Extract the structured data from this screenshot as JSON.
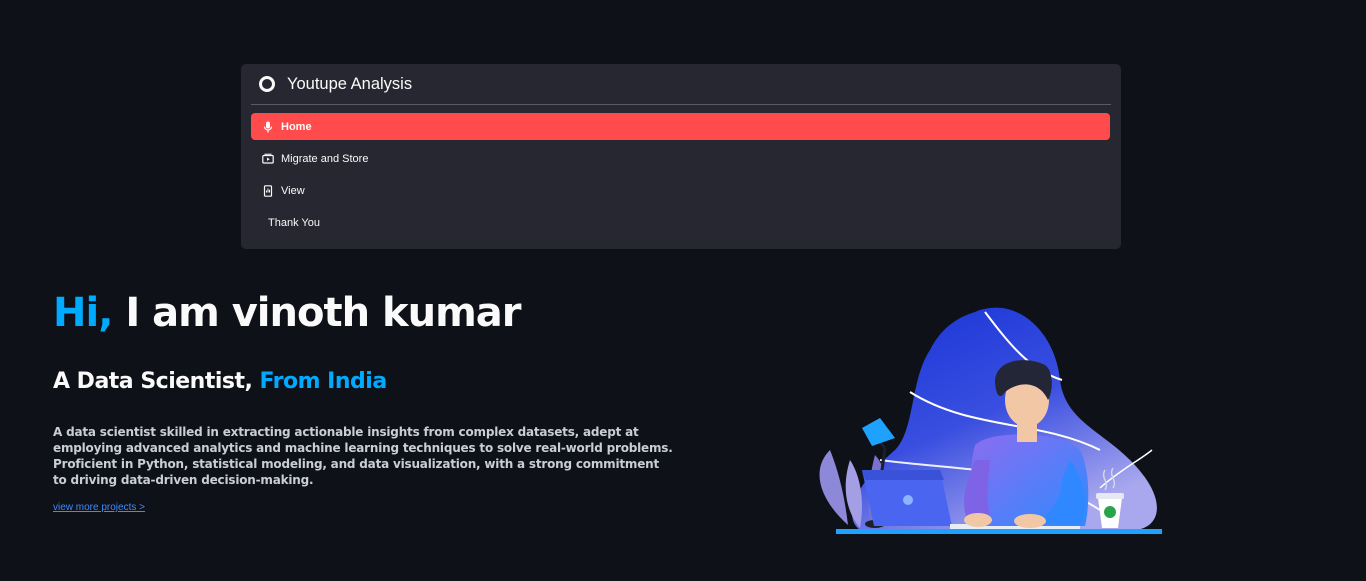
{
  "menu": {
    "title": "Youtupe Analysis",
    "items": [
      {
        "label": "Home",
        "icon": "mic-icon",
        "active": true
      },
      {
        "label": "Migrate and Store",
        "icon": "video-card-icon",
        "active": false
      },
      {
        "label": "View",
        "icon": "phone-chart-icon",
        "active": false
      },
      {
        "label": "Thank You",
        "icon": "",
        "active": false
      }
    ]
  },
  "hero": {
    "greeting": "Hi,",
    "name": " I am vinoth kumar",
    "role": "A Data Scientist, ",
    "origin": "From India",
    "description": "A data scientist skilled in extracting actionable insights from complex datasets, adept at employing advanced analytics and machine learning techniques to solve real-world problems. Proficient in Python, statistical modeling, and data visualization, with a strong commitment to driving data-driven decision-making.",
    "link": "view more projects >"
  },
  "colors": {
    "background": "#0e1117",
    "card": "#262730",
    "active": "#ff4b4b",
    "accent": "#00aaff",
    "link": "#3d8bfd"
  }
}
